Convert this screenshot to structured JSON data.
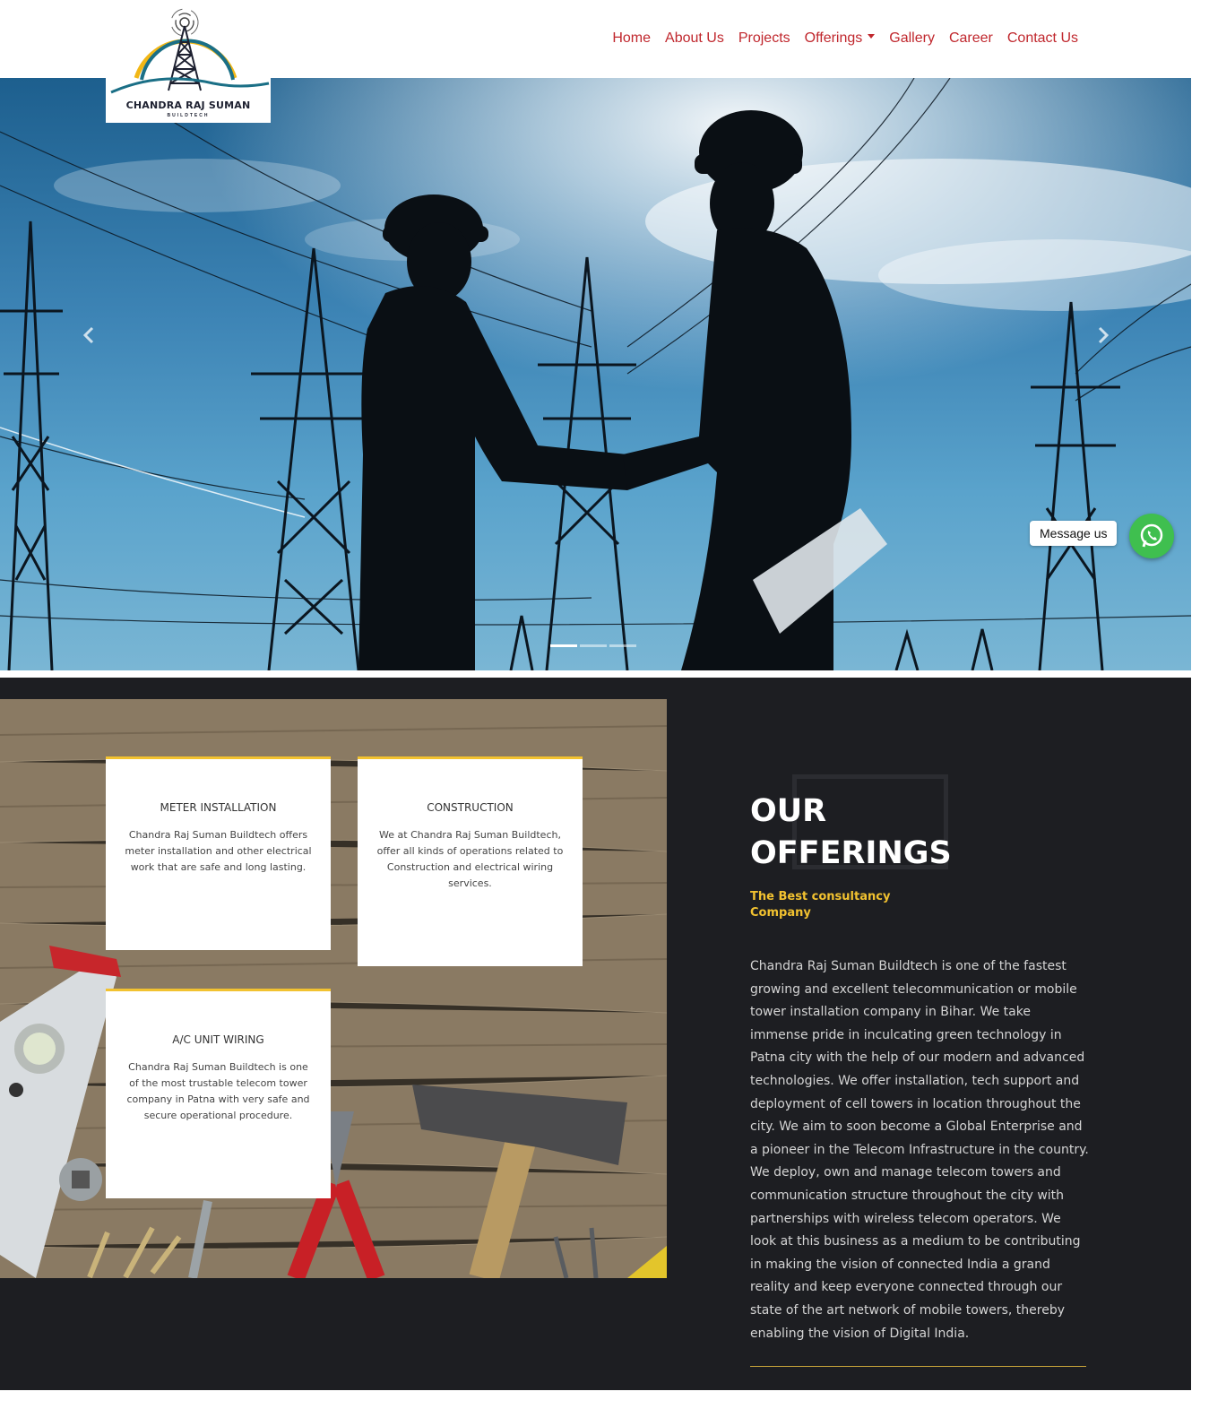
{
  "brand": {
    "name": "CHANDRA RAJ SUMAN",
    "tagline": "BUILDTECH"
  },
  "nav": {
    "items": [
      {
        "label": "Home"
      },
      {
        "label": "About Us"
      },
      {
        "label": "Projects"
      },
      {
        "label": "Offerings",
        "has_dropdown": true
      },
      {
        "label": "Gallery"
      },
      {
        "label": "Career"
      },
      {
        "label": "Contact Us"
      }
    ]
  },
  "hero": {
    "slide_count": 3,
    "active_slide": 1,
    "prev_icon": "chevron-left-icon",
    "next_icon": "chevron-right-icon"
  },
  "whatsapp": {
    "label": "Message us",
    "icon": "whatsapp-icon",
    "color": "#3fbf4f"
  },
  "offerings": {
    "title": "OUR OFFERINGS",
    "subtitle": "The Best consultancy Company",
    "description": "Chandra Raj Suman Buildtech is one of the fastest growing and excellent telecommunication or mobile tower installation company in Bihar. We take immense pride in inculcating green technology in Patna city with the help of our modern and advanced technologies. We offer installation, tech support and deployment of cell towers in location throughout the city. We aim to soon become a Global Enterprise and a pioneer in the Telecom Infrastructure in the country. We deploy, own and manage telecom towers and communication structure throughout the city with partnerships with wireless telecom operators. We look at this business as a medium to be contributing in making the vision of connected India a grand reality and keep everyone connected through our state of the art network of mobile towers, thereby enabling the vision of Digital India.",
    "cards": [
      {
        "title": "METER INSTALLATION",
        "text": "Chandra Raj Suman Buildtech offers meter installation and other electrical work that are safe and long lasting."
      },
      {
        "title": "CONSTRUCTION",
        "text": "We at Chandra Raj Suman Buildtech, offer all kinds of operations related to Construction and electrical wiring services."
      },
      {
        "title": "A/C UNIT WIRING",
        "text": "Chandra Raj Suman Buildtech is one of the most trustable telecom tower company in Patna with very safe and secure operational procedure."
      }
    ]
  },
  "colors": {
    "nav_link": "#c0272d",
    "accent": "#f2c230",
    "section_bg": "#1d1e22"
  }
}
